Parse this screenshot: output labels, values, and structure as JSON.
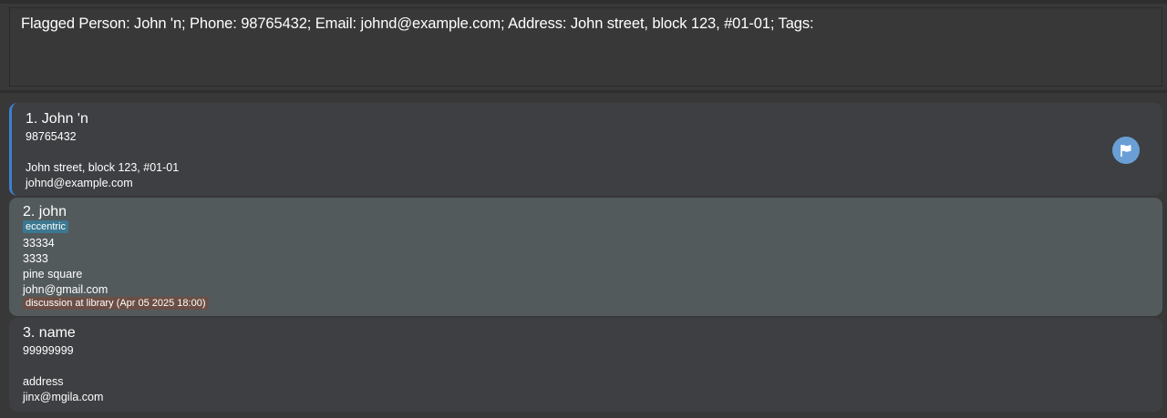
{
  "result": {
    "text": "Flagged Person: John 'n; Phone: 98765432; Email: johnd@example.com; Address: John street, block 123, #01-01; Tags:"
  },
  "persons": [
    {
      "name": "1. John 'n",
      "phone": "98765432",
      "address": "John street, block 123, #01-01",
      "email": "johnd@example.com",
      "flag_icon": "flag-icon"
    },
    {
      "name": "2. john",
      "tag": "eccentric",
      "phone": "33334",
      "extra": "3333",
      "address": "pine square",
      "email": "john@gmail.com",
      "event": "discussion at library (Apr 05 2025 18:00)"
    },
    {
      "name": "3. name",
      "phone": "99999999",
      "address": "address",
      "email": "jinx@mgila.com"
    }
  ],
  "colors": {
    "background": "#383838",
    "card": "#3e3f42",
    "card_highlight": "#535a5c",
    "selected_accent": "#3d7fd0",
    "tag": "#3c7891",
    "event": "#6b4e45",
    "flag_button": "#6a9fd6"
  }
}
